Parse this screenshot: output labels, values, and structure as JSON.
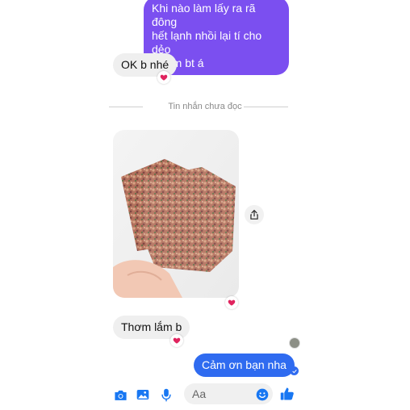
{
  "messages": {
    "outgoing_purple": {
      "line1": "Khi nào làm lấy ra rã đông",
      "line2": "hết lạnh nhồi lại tí cho dẻo",
      "line3": "là làm bt á"
    },
    "incoming_1": "OK b nhé",
    "divider": "Tin nhắn chưa đọc",
    "incoming_2": "Thơm lắm b",
    "outgoing_blue": "Cảm ơn bạn nha"
  },
  "reactions": {
    "heart": "❤️"
  },
  "composer": {
    "placeholder": "Aa"
  },
  "colors": {
    "purple_bubble": "#7b4ff0",
    "blue_bubble": "#2f6bf0",
    "incoming_bubble": "#efefef",
    "accent": "#1877f2"
  },
  "icons": [
    "share-icon",
    "camera-icon",
    "gallery-icon",
    "microphone-icon",
    "emoji-icon",
    "thumbs-up-icon",
    "sent-check-icon"
  ]
}
